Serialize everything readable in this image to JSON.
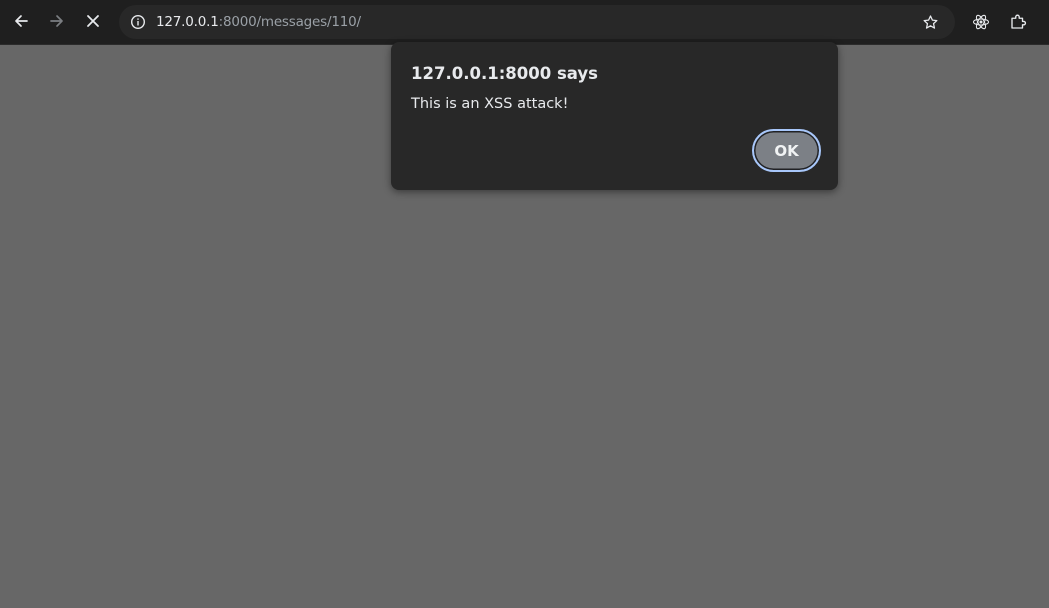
{
  "browser": {
    "url_host": "127.0.0.1",
    "url_rest": ":8000/messages/110/",
    "icons": {
      "back": "arrow-left-icon",
      "forward": "arrow-right-icon",
      "stop": "close-icon",
      "site_info": "info-icon",
      "bookmark": "star-icon",
      "react_devtools": "react-icon",
      "extensions": "puzzle-icon"
    }
  },
  "alert": {
    "title": "127.0.0.1:8000 says",
    "message": "This is an XSS attack!",
    "ok_label": "OK"
  },
  "colors": {
    "page_overlay": "#676767",
    "toolbar": "#1f1f1f",
    "omnibox": "#282828",
    "dialog": "#282828",
    "ok_button": "#7c8086",
    "focus_ring": "#a8c7fa"
  }
}
